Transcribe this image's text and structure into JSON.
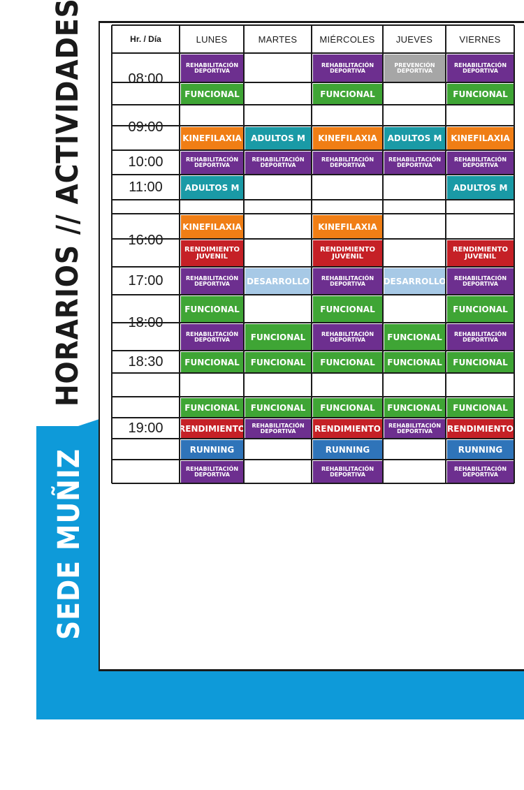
{
  "title": "HORARIOS // ACTIVIDADES",
  "sede": "SEDE MUÑIZ",
  "header": [
    "Hr. / Día",
    "LUNES",
    "MARTES",
    "MIÉRCOLES",
    "JUEVES",
    "VIERNES"
  ],
  "times": [
    "08:00",
    "09:00",
    "10:00",
    "11:00",
    "16:00",
    "17:00",
    "18:00",
    "18:30",
    "19:00"
  ],
  "activities": [
    {
      "col": 1,
      "row": 0,
      "label": "REHABILITACIÓN DEPORTIVA",
      "color": "#6d2f8f"
    },
    {
      "col": 3,
      "row": 0,
      "label": "REHABILITACIÓN DEPORTIVA",
      "color": "#6d2f8f"
    },
    {
      "col": 4,
      "row": 0,
      "label": "PREVENCIÓN DEPORTIVA",
      "color": "#a6a6a6"
    },
    {
      "col": 5,
      "row": 0,
      "label": "REHABILITACIÓN DEPORTIVA",
      "color": "#6d2f8f"
    },
    {
      "col": 1,
      "row": 1,
      "label": "FUNCIONAL",
      "color": "#3fa535"
    },
    {
      "col": 3,
      "row": 1,
      "label": "FUNCIONAL",
      "color": "#3fa535"
    },
    {
      "col": 5,
      "row": 1,
      "label": "FUNCIONAL",
      "color": "#3fa535"
    },
    {
      "col": 1,
      "row": 3,
      "label": "KINEFILAXIA",
      "color": "#f07e15"
    },
    {
      "col": 2,
      "row": 3,
      "label": "ADULTOS M",
      "color": "#1a9aa6"
    },
    {
      "col": 3,
      "row": 3,
      "label": "KINEFILAXIA",
      "color": "#f07e15"
    },
    {
      "col": 4,
      "row": 3,
      "label": "ADULTOS M",
      "color": "#1a9aa6"
    },
    {
      "col": 5,
      "row": 3,
      "label": "KINEFILAXIA",
      "color": "#f07e15"
    },
    {
      "col": 1,
      "row": 4,
      "label": "REHABILITACIÓN DEPORTIVA",
      "color": "#6d2f8f"
    },
    {
      "col": 2,
      "row": 4,
      "label": "REHABILITACIÓN DEPORTIVA",
      "color": "#6d2f8f"
    },
    {
      "col": 3,
      "row": 4,
      "label": "REHABILITACIÓN DEPORTIVA",
      "color": "#6d2f8f"
    },
    {
      "col": 4,
      "row": 4,
      "label": "REHABILITACIÓN DEPORTIVA",
      "color": "#6d2f8f"
    },
    {
      "col": 5,
      "row": 4,
      "label": "REHABILITACIÓN DEPORTIVA",
      "color": "#6d2f8f"
    },
    {
      "col": 1,
      "row": 5,
      "label": "ADULTOS M",
      "color": "#1a9aa6"
    },
    {
      "col": 5,
      "row": 5,
      "label": "ADULTOS M",
      "color": "#1a9aa6"
    },
    {
      "col": 1,
      "row": 7,
      "label": "KINEFILAXIA",
      "color": "#f07e15"
    },
    {
      "col": 3,
      "row": 7,
      "label": "KINEFILAXIA",
      "color": "#f07e15"
    },
    {
      "col": 1,
      "row": 8,
      "label": "RENDIMIENTO JUVENIL",
      "color": "#c52026"
    },
    {
      "col": 3,
      "row": 8,
      "label": "RENDIMIENTO JUVENIL",
      "color": "#c52026"
    },
    {
      "col": 5,
      "row": 8,
      "label": "RENDIMIENTO JUVENIL",
      "color": "#c52026"
    },
    {
      "col": 1,
      "row": 9,
      "label": "REHABILITACIÓN DEPORTIVA",
      "color": "#6d2f8f"
    },
    {
      "col": 2,
      "row": 9,
      "label": "DESARROLLO",
      "color": "#a7c9e6"
    },
    {
      "col": 3,
      "row": 9,
      "label": "REHABILITACIÓN DEPORTIVA",
      "color": "#6d2f8f"
    },
    {
      "col": 4,
      "row": 9,
      "label": "DESARROLLO",
      "color": "#a7c9e6"
    },
    {
      "col": 5,
      "row": 9,
      "label": "REHABILITACIÓN DEPORTIVA",
      "color": "#6d2f8f"
    },
    {
      "col": 1,
      "row": 10,
      "label": "FUNCIONAL",
      "color": "#3fa535"
    },
    {
      "col": 3,
      "row": 10,
      "label": "FUNCIONAL",
      "color": "#3fa535"
    },
    {
      "col": 5,
      "row": 10,
      "label": "FUNCIONAL",
      "color": "#3fa535"
    },
    {
      "col": 1,
      "row": 11,
      "label": "REHABILITACIÓN DEPORTIVA",
      "color": "#6d2f8f"
    },
    {
      "col": 2,
      "row": 11,
      "label": "FUNCIONAL",
      "color": "#3fa535"
    },
    {
      "col": 3,
      "row": 11,
      "label": "REHABILITACIÓN DEPORTIVA",
      "color": "#6d2f8f"
    },
    {
      "col": 4,
      "row": 11,
      "label": "FUNCIONAL",
      "color": "#3fa535"
    },
    {
      "col": 5,
      "row": 11,
      "label": "REHABILITACIÓN DEPORTIVA",
      "color": "#6d2f8f"
    },
    {
      "col": 1,
      "row": 12,
      "label": "FUNCIONAL",
      "color": "#3fa535"
    },
    {
      "col": 2,
      "row": 12,
      "label": "FUNCIONAL",
      "color": "#3fa535"
    },
    {
      "col": 3,
      "row": 12,
      "label": "FUNCIONAL",
      "color": "#3fa535"
    },
    {
      "col": 4,
      "row": 12,
      "label": "FUNCIONAL",
      "color": "#3fa535"
    },
    {
      "col": 5,
      "row": 12,
      "label": "FUNCIONAL",
      "color": "#3fa535"
    },
    {
      "col": 1,
      "row": 14,
      "label": "FUNCIONAL",
      "color": "#3fa535"
    },
    {
      "col": 2,
      "row": 14,
      "label": "FUNCIONAL",
      "color": "#3fa535"
    },
    {
      "col": 3,
      "row": 14,
      "label": "FUNCIONAL",
      "color": "#3fa535"
    },
    {
      "col": 4,
      "row": 14,
      "label": "FUNCIONAL",
      "color": "#3fa535"
    },
    {
      "col": 5,
      "row": 14,
      "label": "FUNCIONAL",
      "color": "#3fa535"
    },
    {
      "col": 1,
      "row": 15,
      "label": "RENDIMIENTO",
      "color": "#c52026"
    },
    {
      "col": 2,
      "row": 15,
      "label": "REHABILITACIÓN DEPORTIVA",
      "color": "#6d2f8f"
    },
    {
      "col": 3,
      "row": 15,
      "label": "RENDIMIENTO",
      "color": "#c52026"
    },
    {
      "col": 4,
      "row": 15,
      "label": "REHABILITACIÓN DEPORTIVA",
      "color": "#6d2f8f"
    },
    {
      "col": 5,
      "row": 15,
      "label": "RENDIMIENTO",
      "color": "#c52026"
    },
    {
      "col": 1,
      "row": 16,
      "label": "RUNNING",
      "color": "#2f74b9"
    },
    {
      "col": 3,
      "row": 16,
      "label": "RUNNING",
      "color": "#2f74b9"
    },
    {
      "col": 5,
      "row": 16,
      "label": "RUNNING",
      "color": "#2f74b9"
    },
    {
      "col": 1,
      "row": 17,
      "label": "REHABILITACIÓN DEPORTIVA",
      "color": "#6d2f8f"
    },
    {
      "col": 3,
      "row": 17,
      "label": "REHABILITACIÓN DEPORTIVA",
      "color": "#6d2f8f"
    },
    {
      "col": 5,
      "row": 17,
      "label": "REHABILITACIÓN DEPORTIVA",
      "color": "#6d2f8f"
    }
  ]
}
